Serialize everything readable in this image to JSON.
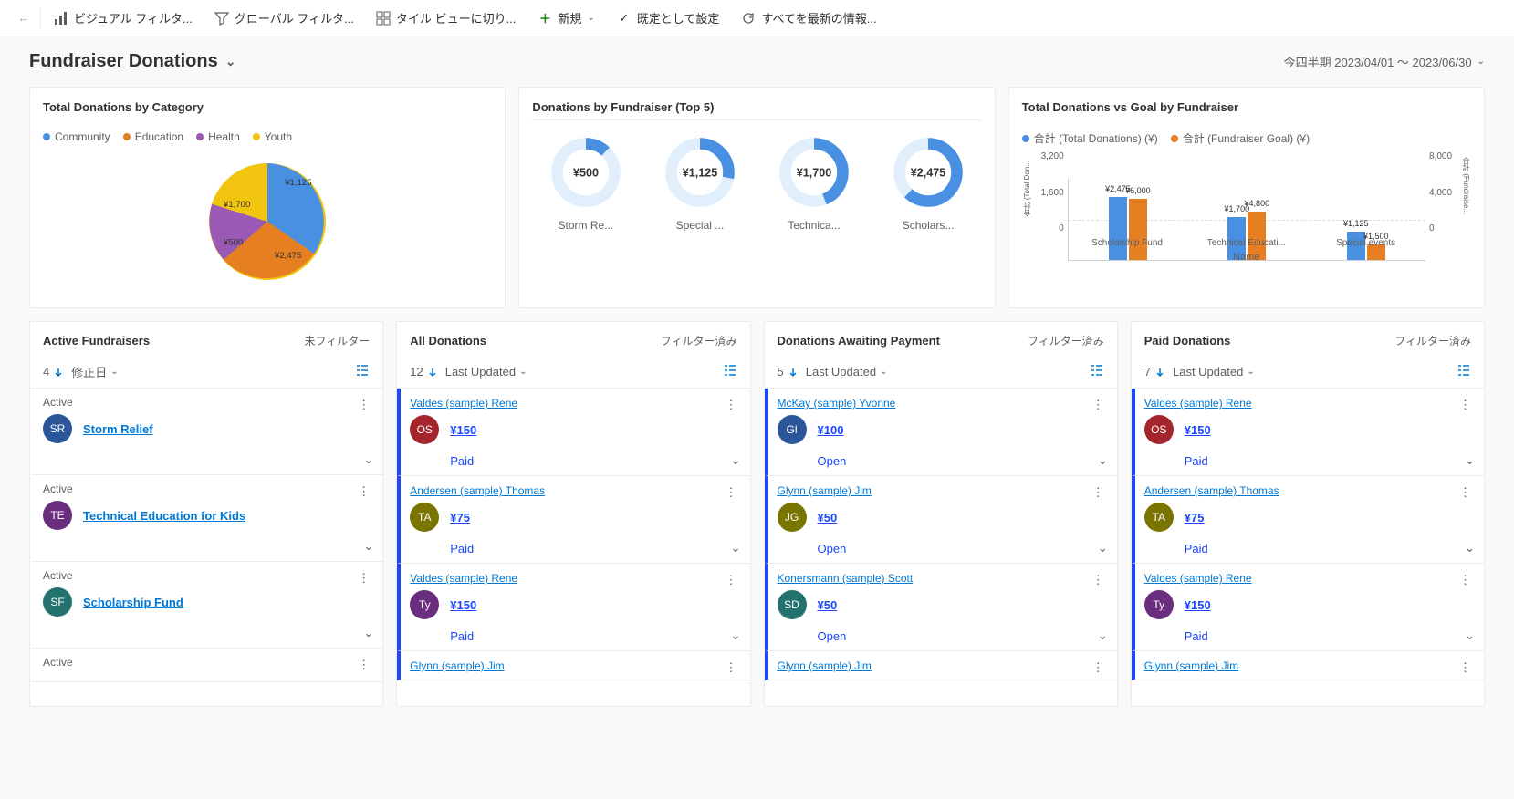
{
  "toolbar": {
    "visual_filter": "ビジュアル フィルタ...",
    "global_filter": "グローバル フィルタ...",
    "tile_view": "タイル ビューに切り...",
    "new": "新規",
    "set_default": "既定として設定",
    "refresh": "すべてを最新の情報..."
  },
  "header": {
    "title": "Fundraiser Donations",
    "date_range": "今四半期 2023/04/01 ～ 2023/06/30"
  },
  "pie": {
    "title": "Total Donations by Category",
    "legend": [
      {
        "label": "Community",
        "color": "#4a90e2"
      },
      {
        "label": "Education",
        "color": "#e67e22"
      },
      {
        "label": "Health",
        "color": "#9b59b6"
      },
      {
        "label": "Youth",
        "color": "#f1c40f"
      }
    ],
    "labels": [
      "¥1,125",
      "¥2,475",
      "¥500",
      "¥1,700"
    ]
  },
  "donuts": {
    "title": "Donations by Fundraiser (Top 5)",
    "items": [
      {
        "value": "¥500",
        "pct": 12,
        "label": "Storm Re..."
      },
      {
        "value": "¥1,125",
        "pct": 28,
        "label": "Special ..."
      },
      {
        "value": "¥1,700",
        "pct": 44,
        "label": "Technica..."
      },
      {
        "value": "¥2,475",
        "pct": 62,
        "label": "Scholars..."
      }
    ]
  },
  "bars": {
    "title": "Total Donations vs Goal by Fundraiser",
    "legend": [
      {
        "label": "合計 (Total Donations) (¥)",
        "color": "#4a90e2"
      },
      {
        "label": "合計 (Fundraiser Goal) (¥)",
        "color": "#e67e22"
      }
    ],
    "y_left": [
      "3,200",
      "1,600",
      "0"
    ],
    "y_right": [
      "8,000",
      "4,000",
      "0"
    ],
    "y_title_left": "合計 (Total Don...",
    "y_title_right": "合計 (Fundraise...",
    "groups": [
      {
        "cat": "Scholarship Fund",
        "a_label": "¥2,475",
        "a_h": 77,
        "b_label": "¥6,000",
        "b_h": 75
      },
      {
        "cat": "Technical Educati...",
        "a_label": "¥1,700",
        "a_h": 53,
        "b_label": "¥4,800",
        "b_h": 60
      },
      {
        "cat": "Special events",
        "a_label": "¥1,125",
        "a_h": 35,
        "b_label": "¥1,500",
        "b_h": 19
      }
    ],
    "xlabel": "Name"
  },
  "lists": {
    "unfiltered": "未フィルター",
    "filtered": "フィルター済み",
    "modified": "修正日",
    "last_updated": "Last Updated",
    "active": {
      "title": "Active Fundraisers",
      "count": "4",
      "items": [
        {
          "status": "Active",
          "name": "Storm Relief",
          "initials": "SR",
          "color": "#2b579a"
        },
        {
          "status": "Active",
          "name": "Technical Education for Kids",
          "initials": "TE",
          "color": "#6b2e7e"
        },
        {
          "status": "Active",
          "name": "Scholarship Fund",
          "initials": "SF",
          "color": "#24726d"
        },
        {
          "status": "Active",
          "name": "",
          "initials": "",
          "color": ""
        }
      ]
    },
    "all": {
      "title": "All Donations",
      "count": "12",
      "items": [
        {
          "name": "Valdes (sample) Rene",
          "amount": "¥150",
          "status": "Paid",
          "initials": "OS",
          "color": "#a4262c"
        },
        {
          "name": "Andersen (sample) Thomas",
          "amount": "¥75",
          "status": "Paid",
          "initials": "TA",
          "color": "#7a7400"
        },
        {
          "name": "Valdes (sample) Rene",
          "amount": "¥150",
          "status": "Paid",
          "initials": "Ty",
          "color": "#6b2e7e"
        },
        {
          "name": "Glynn (sample) Jim",
          "amount": "",
          "status": "",
          "initials": "",
          "color": ""
        }
      ]
    },
    "awaiting": {
      "title": "Donations Awaiting Payment",
      "count": "5",
      "items": [
        {
          "name": "McKay (sample) Yvonne",
          "amount": "¥100",
          "status": "Open",
          "initials": "Gl",
          "color": "#2b579a"
        },
        {
          "name": "Glynn (sample) Jim",
          "amount": "¥50",
          "status": "Open",
          "initials": "JG",
          "color": "#7a7400"
        },
        {
          "name": "Konersmann (sample) Scott",
          "amount": "¥50",
          "status": "Open",
          "initials": "SD",
          "color": "#24726d"
        },
        {
          "name": "Glynn (sample) Jim",
          "amount": "",
          "status": "",
          "initials": "",
          "color": ""
        }
      ]
    },
    "paid": {
      "title": "Paid Donations",
      "count": "7",
      "items": [
        {
          "name": "Valdes (sample) Rene",
          "amount": "¥150",
          "status": "Paid",
          "initials": "OS",
          "color": "#a4262c"
        },
        {
          "name": "Andersen (sample) Thomas",
          "amount": "¥75",
          "status": "Paid",
          "initials": "TA",
          "color": "#7a7400"
        },
        {
          "name": "Valdes (sample) Rene",
          "amount": "¥150",
          "status": "Paid",
          "initials": "Ty",
          "color": "#6b2e7e"
        },
        {
          "name": "Glynn (sample) Jim",
          "amount": "",
          "status": "",
          "initials": "",
          "color": ""
        }
      ]
    }
  },
  "chart_data": [
    {
      "type": "pie",
      "title": "Total Donations by Category",
      "series": [
        {
          "name": "Community",
          "value": 1125
        },
        {
          "name": "Education",
          "value": 2475
        },
        {
          "name": "Health",
          "value": 500
        },
        {
          "name": "Youth",
          "value": 1700
        }
      ]
    },
    {
      "type": "donut-multiples",
      "title": "Donations by Fundraiser (Top 5)",
      "items": [
        {
          "name": "Storm Relief",
          "value": 500
        },
        {
          "name": "Special events",
          "value": 1125
        },
        {
          "name": "Technical Education",
          "value": 1700
        },
        {
          "name": "Scholarship Fund",
          "value": 2475
        }
      ]
    },
    {
      "type": "bar",
      "title": "Total Donations vs Goal by Fundraiser",
      "categories": [
        "Scholarship Fund",
        "Technical Education",
        "Special events"
      ],
      "series": [
        {
          "name": "Total Donations (¥)",
          "values": [
            2475,
            1700,
            1125
          ]
        },
        {
          "name": "Fundraiser Goal (¥)",
          "values": [
            6000,
            4800,
            1500
          ]
        }
      ],
      "y_left_lim": [
        0,
        3200
      ],
      "y_right_lim": [
        0,
        8000
      ],
      "xlabel": "Name"
    }
  ]
}
